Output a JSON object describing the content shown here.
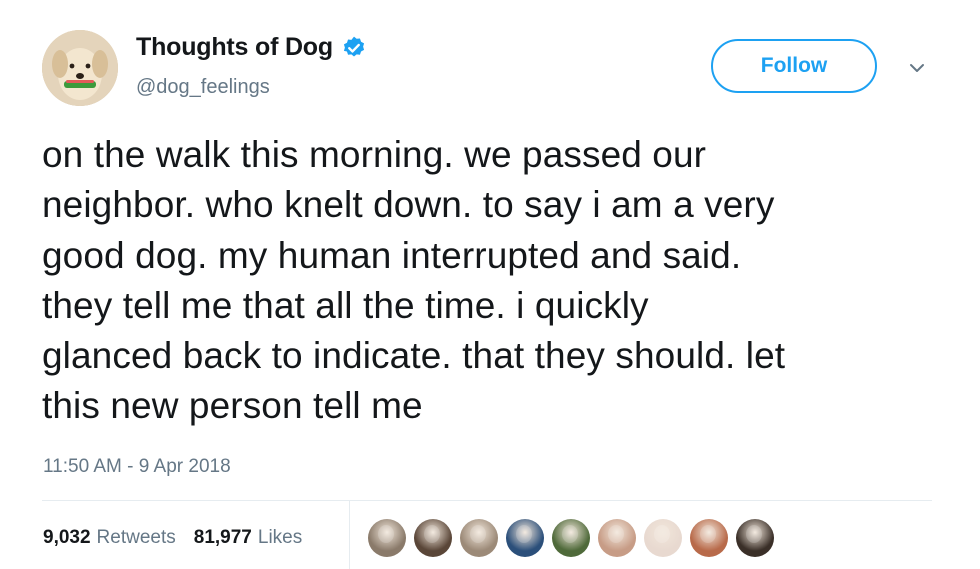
{
  "author": {
    "display_name": "Thoughts of Dog",
    "handle": "@dog_feelings",
    "verified_icon": "verified-badge-icon",
    "verified_color": "#1da1f2"
  },
  "follow_label": "Follow",
  "tweet_text": "on the walk this morning. we passed our\nneighbor. who knelt down. to say i am a very\ngood dog. my human interrupted and said.\nthey tell me that all the time. i quickly\nglanced back to indicate. that they should. let\nthis new person tell me",
  "timestamp": "11:50 AM - 9 Apr 2018",
  "stats": {
    "retweets_count": "9,032",
    "retweets_label": "Retweets",
    "likes_count": "81,977",
    "likes_label": "Likes"
  },
  "likers": [
    {
      "color": "#8a7a6a"
    },
    {
      "color": "#5a4638"
    },
    {
      "color": "#9c8a78"
    },
    {
      "color": "#2b4f7a"
    },
    {
      "color": "#4f6a3a"
    },
    {
      "color": "#c79c86"
    },
    {
      "color": "#e8d9d0"
    },
    {
      "color": "#b86a4a"
    },
    {
      "color": "#3a2f28"
    }
  ],
  "colors": {
    "accent": "#1da1f2",
    "text_primary": "#14171a",
    "text_secondary": "#657786",
    "divider": "#e6ecf0"
  }
}
